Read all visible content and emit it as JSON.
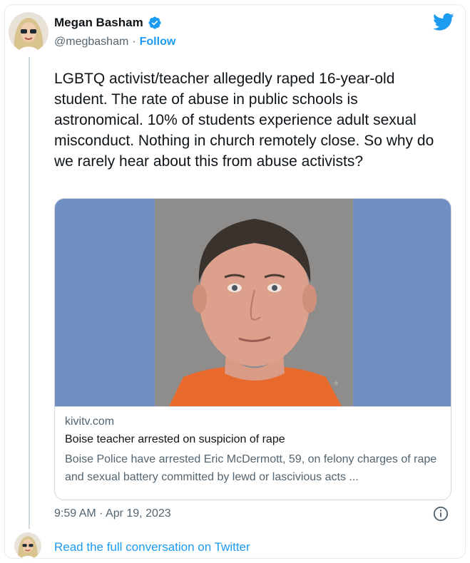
{
  "author": {
    "name": "Megan Basham",
    "handle": "@megbasham",
    "separator": "·",
    "follow_label": "Follow",
    "verified": true
  },
  "brand": {
    "logo_icon": "twitter-bird-icon",
    "color": "#1d9bf0"
  },
  "tweet": {
    "text": "LGBTQ activist/teacher allegedly raped 16-year-old student. The rate of abuse in public schools is astronomical. 10% of students experience adult sexual misconduct. Nothing in church remotely close. So why do we rarely hear about this from abuse activists?",
    "timestamp": "9:59 AM · Apr 19, 2023"
  },
  "link_card": {
    "domain": "kivitv.com",
    "title": "Boise teacher arrested on suspicion of rape",
    "description": "Boise Police have arrested Eric McDermott, 59, on felony charges of rape and sexual battery committed by lewd or lascivious acts ..."
  },
  "footer": {
    "read_more_label": "Read the full conversation on Twitter"
  },
  "colors": {
    "text": "#0f1419",
    "secondary": "#536471",
    "link": "#1d9bf0",
    "border": "#cfd9de",
    "media_bg": "#6f8fc3"
  }
}
